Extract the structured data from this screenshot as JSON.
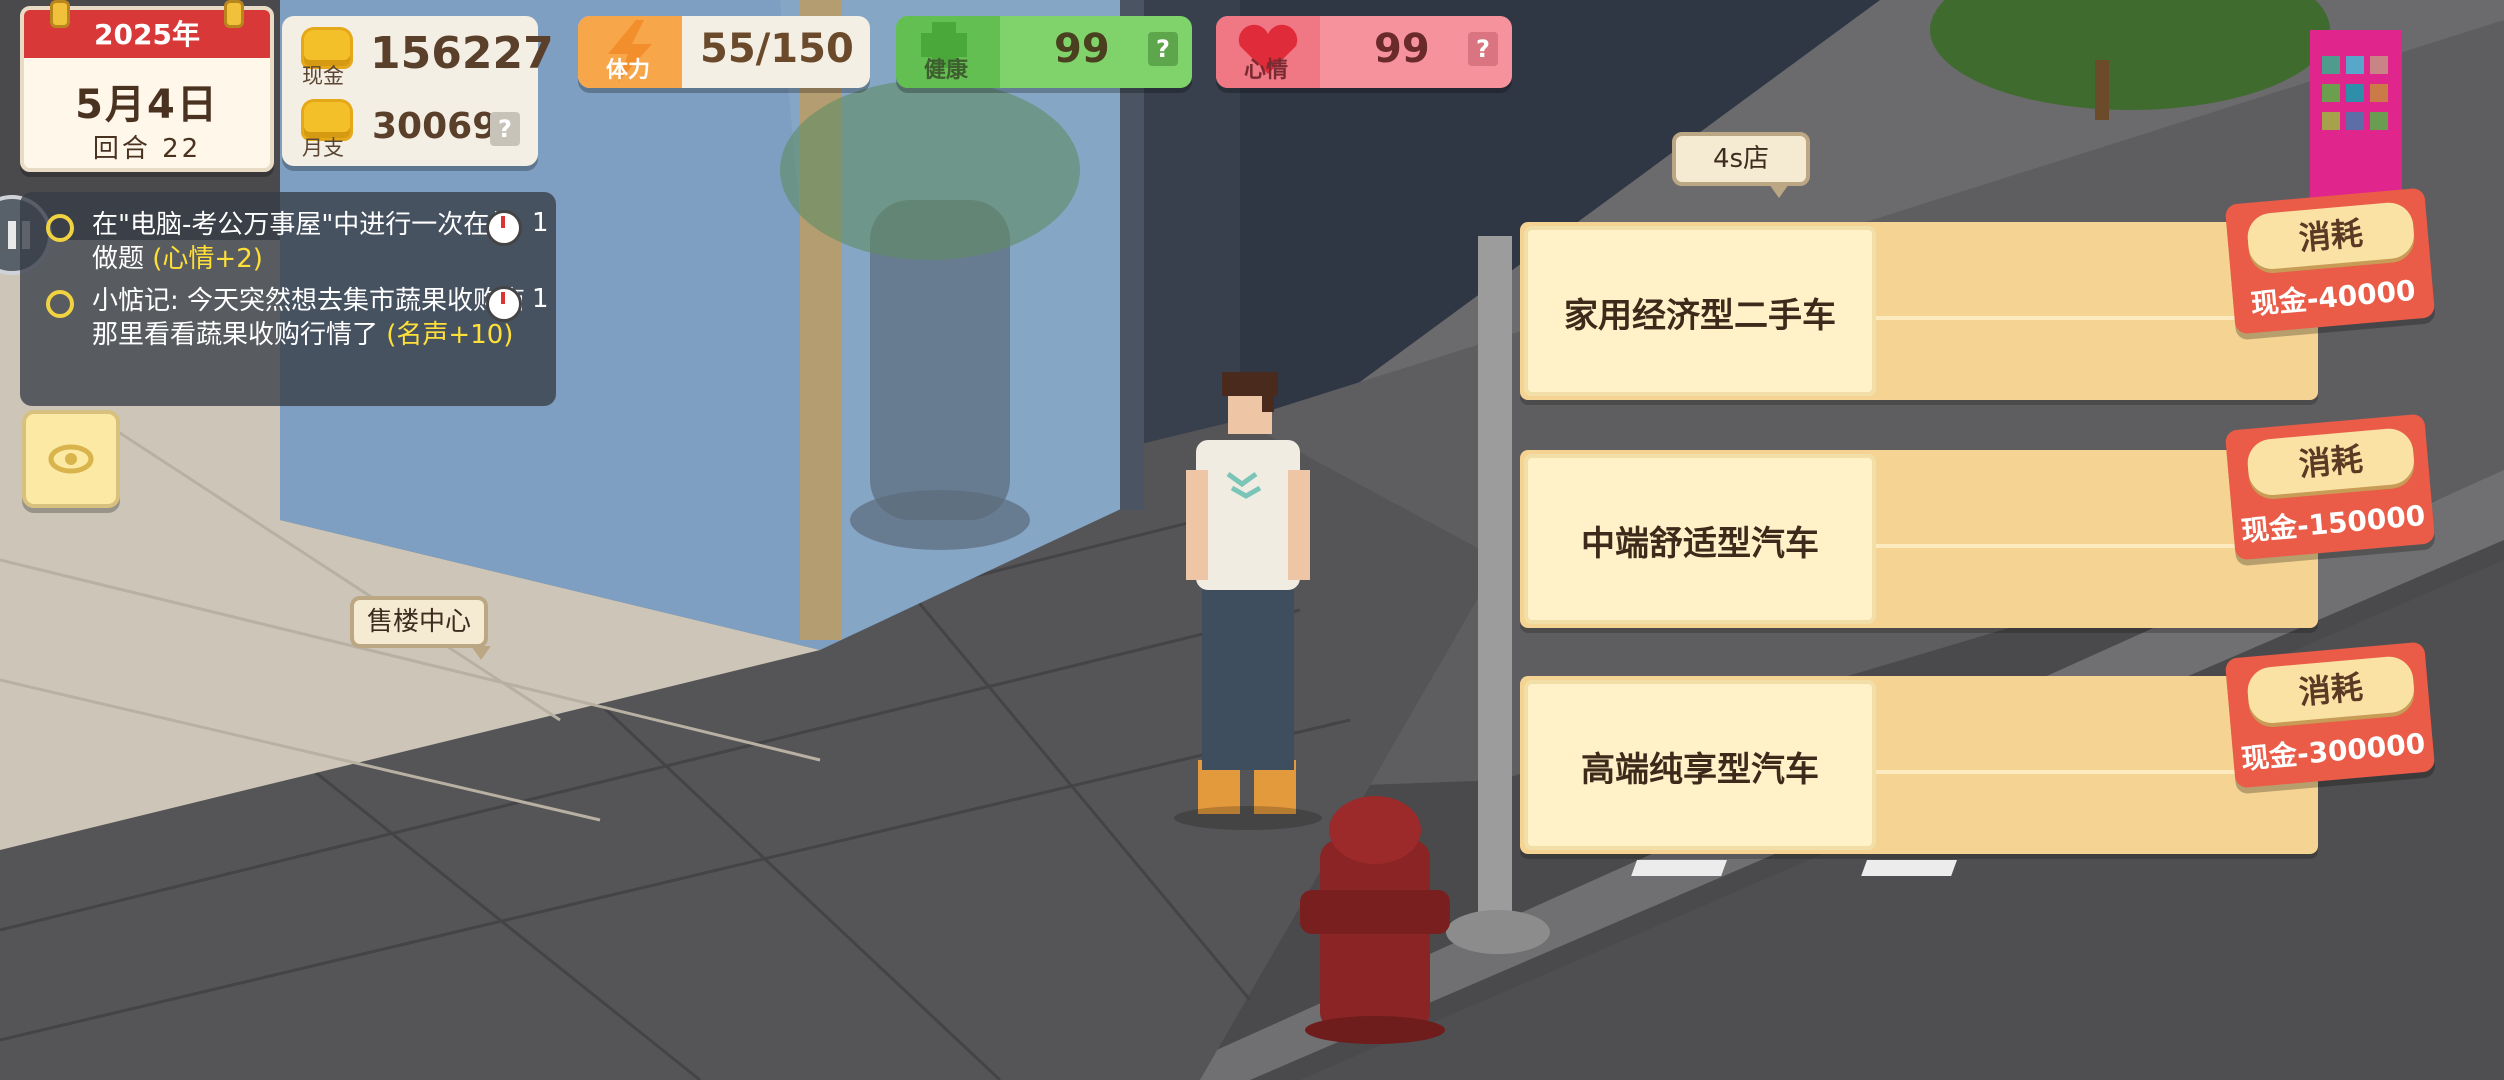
{
  "hud": {
    "calendar": {
      "year": "2025年",
      "date": "5月4日",
      "round": "回合 22"
    },
    "cash": {
      "label": "现金",
      "value": "156227"
    },
    "monthly": {
      "label": "月支",
      "value": "30069",
      "help": "?"
    },
    "stamina": {
      "label": "体力",
      "value": "55/150"
    },
    "health": {
      "label": "健康",
      "value": "99",
      "help": "?"
    },
    "mood": {
      "label": "心情",
      "value": "99",
      "help": "?"
    }
  },
  "quests": [
    {
      "text": "在\"电脑-考公万事屋\"中进行一次在线做题",
      "reward": "(心情+2)",
      "count": "1"
    },
    {
      "text": "小惦记: 今天突然想去集市蔬果收购商那里看看蔬果收购行情了",
      "reward": "(名声+10)",
      "count": "1"
    }
  ],
  "map_labels": {
    "sales_center": "售楼中心",
    "car_shop": "4s店"
  },
  "car_shop": {
    "options": [
      {
        "name": "家用经济型二手车",
        "action": "消耗",
        "cost": "现金-40000"
      },
      {
        "name": "中端舒适型汽车",
        "action": "消耗",
        "cost": "现金-150000"
      },
      {
        "name": "高端纯享型汽车",
        "action": "消耗",
        "cost": "现金-300000"
      }
    ]
  },
  "colors": {
    "stamina": "#f7a64a",
    "health": "#6fcf63",
    "mood": "#f26b78",
    "cost_badge": "#ea5b48",
    "option_panel": "#f5d392"
  },
  "icons": [
    "pause-icon",
    "eye-icon",
    "coin-icon",
    "lightning-icon",
    "health-cross-icon",
    "heart-icon",
    "timer-icon"
  ]
}
